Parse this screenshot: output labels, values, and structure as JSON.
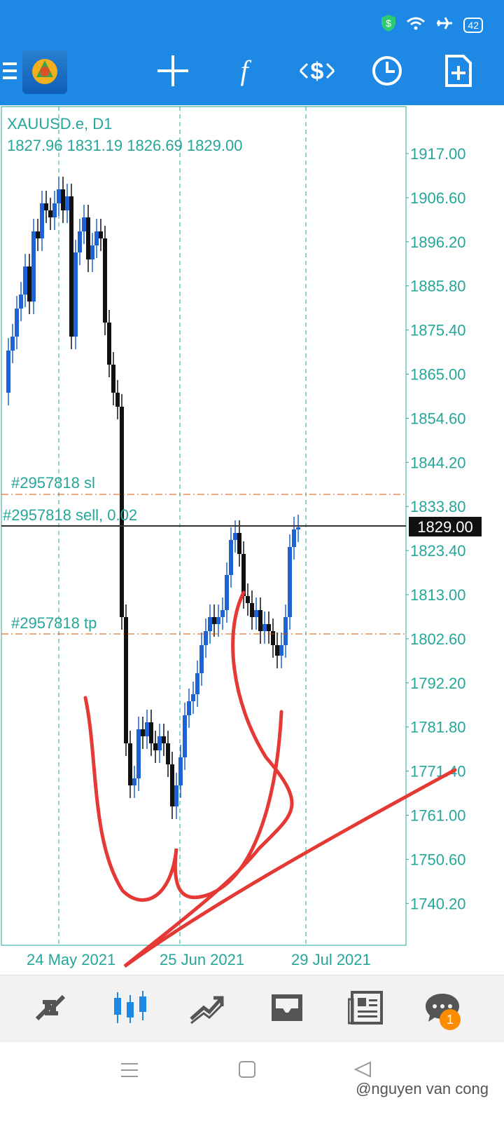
{
  "status_bar": {
    "battery": "42"
  },
  "toolbar": {
    "icons": [
      "menu-icon",
      "app-logo",
      "crosshair-icon",
      "indicators-icon",
      "trade-icon",
      "timeframe-icon",
      "new-order-icon"
    ]
  },
  "chart": {
    "symbol_timeframe": "XAUUSD.e, D1",
    "ohlc": "1827.96 1831.19 1826.69 1829.00",
    "sl_label": "#2957818 sl",
    "sell_label": "#2957818 sell, 0.02",
    "tp_label": "#2957818 tp",
    "current_price": "1829.00",
    "price_axis": [
      "1917.00",
      "1906.60",
      "1896.20",
      "1885.80",
      "1875.40",
      "1865.00",
      "1854.60",
      "1844.20",
      "1833.80",
      "1823.40",
      "1813.00",
      "1802.60",
      "1792.20",
      "1781.80",
      "1771.40",
      "1761.00",
      "1750.60",
      "1740.20"
    ],
    "date_axis": [
      "24 May 2021",
      "25 Jun 2021",
      "29 Jul 2021"
    ],
    "colors": {
      "axis_text": "#26a69a",
      "bull_candle": "#1e63d6",
      "bear_candle": "#111111",
      "trade_line": "#d35400",
      "drawing": "#e53935"
    }
  },
  "chart_data": {
    "type": "candlestick",
    "ylim": [
      1733,
      1926
    ],
    "ohlc_sample": "1827.96 1831.19 1826.69 1829.00",
    "levels": {
      "sl": 1836.3,
      "entry": 1829.0,
      "tp": 1803.5
    }
  },
  "bottom_nav": {
    "items": [
      "quotes-icon",
      "chart-icon",
      "trade-icon",
      "history-icon",
      "news-icon",
      "chat-icon"
    ],
    "chat_badge": "1"
  },
  "watermark": "@nguyen van cong"
}
